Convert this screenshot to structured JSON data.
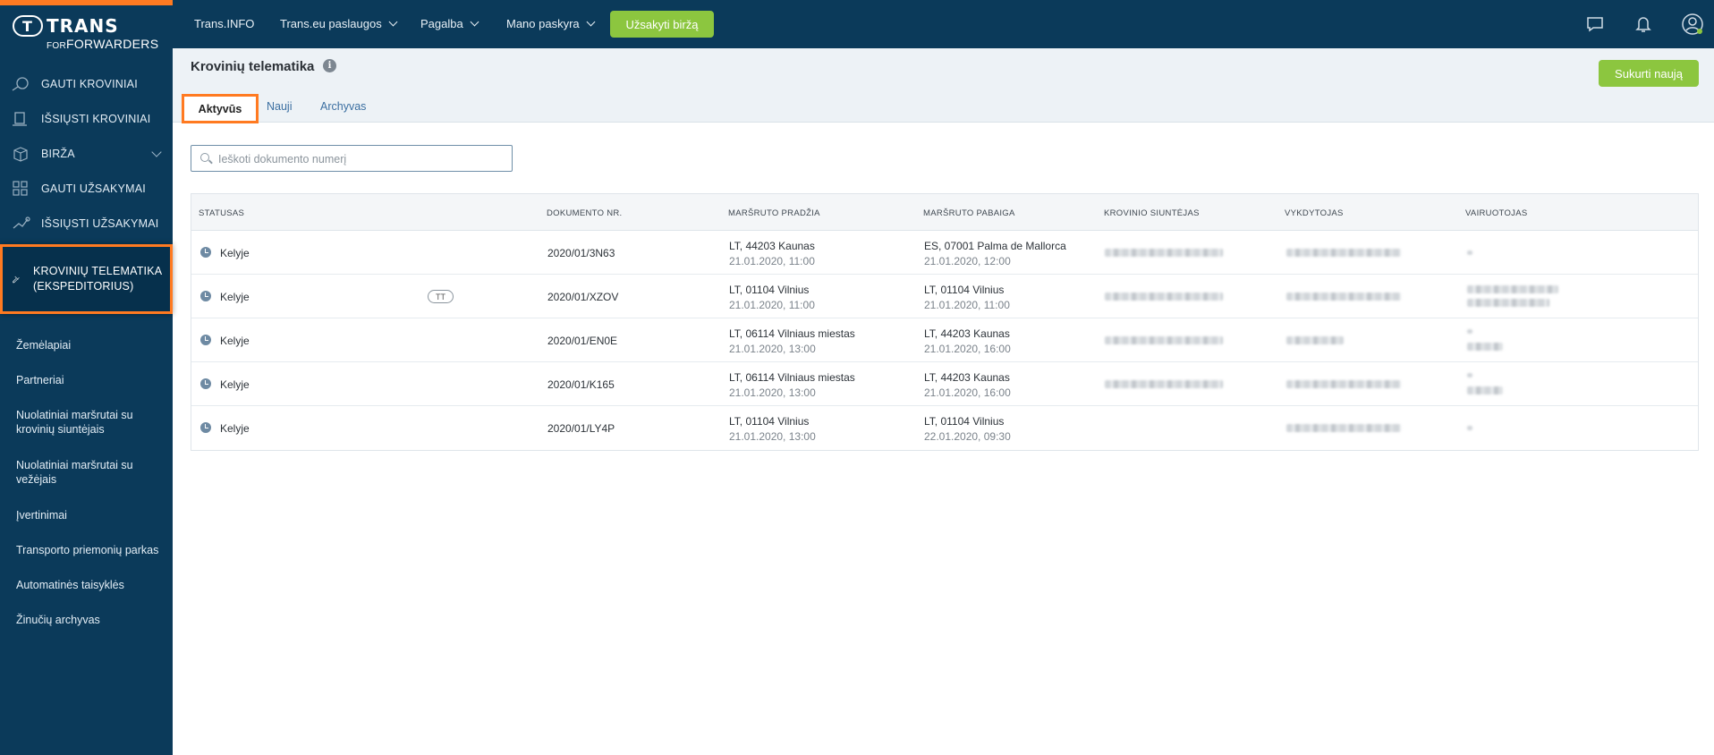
{
  "logo": {
    "badge": "T",
    "word1": "TRANS",
    "word2_prefix": "FOR",
    "word2": "FORWARDERS"
  },
  "sidebar": {
    "main_items": [
      {
        "label": "GAUTI KROVINIAI",
        "icon": "cargo-received-icon"
      },
      {
        "label": "IŠSIŲSTI KROVINIAI",
        "icon": "cargo-sent-icon"
      },
      {
        "label": "BIRŽA",
        "icon": "box-icon",
        "has_chevron": true
      },
      {
        "label": "GAUTI UŽSAKYMAI",
        "icon": "grid-icon"
      },
      {
        "label": "IŠSIŲSTI UŽSAKYMAI",
        "icon": "orders-sent-icon"
      },
      {
        "label": "KROVINIŲ TELEMATIKA (EKSPEDITORIUS)",
        "icon": "satellite-icon",
        "active": true
      }
    ],
    "sub_items": [
      "Žemėlapiai",
      "Partneriai",
      "Nuolatiniai maršrutai su krovinių siuntėjais",
      "Nuolatiniai maršrutai su vežėjais",
      "Įvertinimai",
      "Transporto priemonių parkas",
      "Automatinės taisyklės",
      "Žinučių archyvas"
    ]
  },
  "topbar": {
    "links": [
      "Trans.INFO",
      "Trans.eu paslaugos",
      "Pagalba",
      "Mano paskyra"
    ],
    "order_button": "Užsakyti biržą",
    "icons": [
      "chat-icon",
      "bell-icon",
      "user-icon"
    ]
  },
  "header": {
    "title": "Krovinių telematika",
    "create_button": "Sukurti naują",
    "tabs": [
      "Aktyvūs",
      "Nauji",
      "Archyvas"
    ]
  },
  "search": {
    "placeholder": "Ieškoti dokumento numerį"
  },
  "table": {
    "headers": [
      "STATUSAS",
      "DOKUMENTO NR.",
      "MARŠRUTO PRADŽIA",
      "MARŠRUTO PABAIGA",
      "KROVINIO SIUNTĖJAS",
      "VYKDYTOJAS",
      "VAIRUOTOJAS"
    ],
    "rows": [
      {
        "status": "Kelyje",
        "tag": "",
        "doc": "2020/01/3N63",
        "start_place": "LT, 44203 Kaunas",
        "start_time": "21.01.2020, 11:00",
        "end_place": "ES, 07001 Palma de Mallorca",
        "end_time": "21.01.2020, 12:00"
      },
      {
        "status": "Kelyje",
        "tag": "TT",
        "doc": "2020/01/XZOV",
        "start_place": "LT, 01104 Vilnius",
        "start_time": "21.01.2020, 11:00",
        "end_place": "LT, 01104 Vilnius",
        "end_time": "21.01.2020, 11:00"
      },
      {
        "status": "Kelyje",
        "tag": "",
        "doc": "2020/01/EN0E",
        "start_place": "LT, 06114 Vilniaus miestas",
        "start_time": "21.01.2020, 13:00",
        "end_place": "LT, 44203 Kaunas",
        "end_time": "21.01.2020, 16:00"
      },
      {
        "status": "Kelyje",
        "tag": "",
        "doc": "2020/01/K165",
        "start_place": "LT, 06114 Vilniaus miestas",
        "start_time": "21.01.2020, 13:00",
        "end_place": "LT, 44203 Kaunas",
        "end_time": "21.01.2020, 16:00"
      },
      {
        "status": "Kelyje",
        "tag": "",
        "doc": "2020/01/LY4P",
        "start_place": "LT, 01104 Vilnius",
        "start_time": "21.01.2020, 13:00",
        "end_place": "LT, 01104 Vilnius",
        "end_time": "22.01.2020, 09:30"
      }
    ]
  }
}
